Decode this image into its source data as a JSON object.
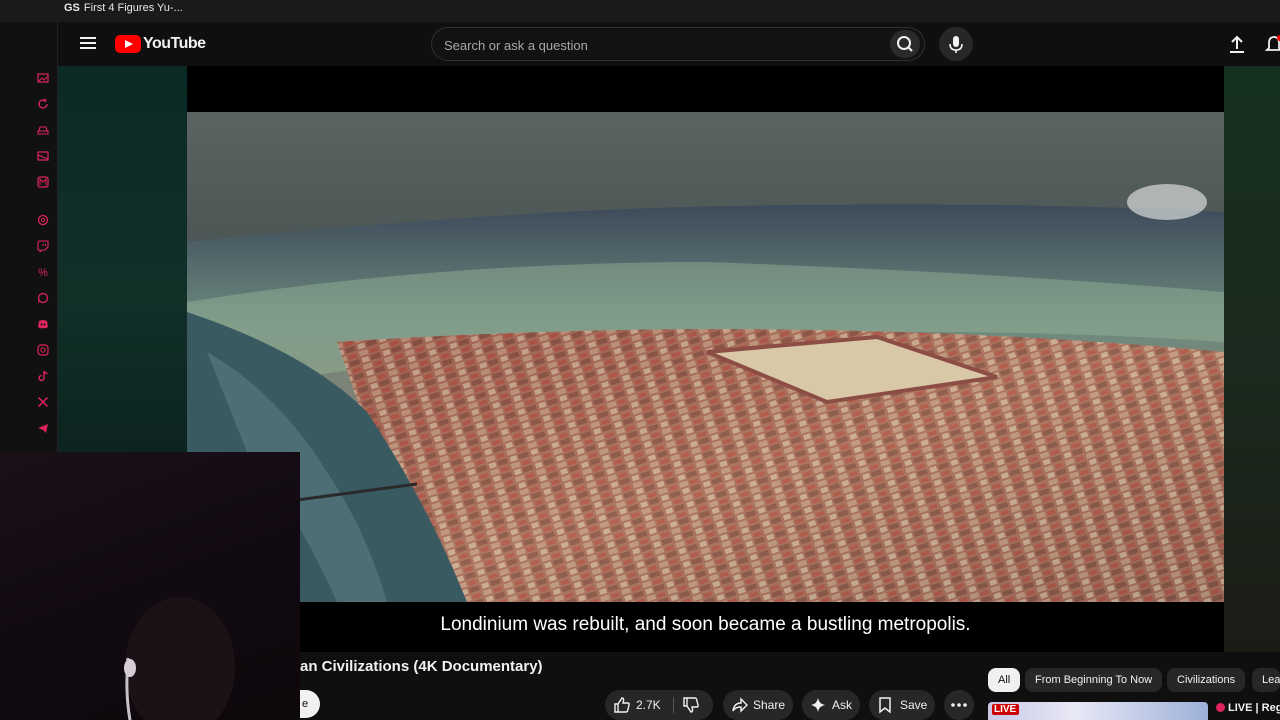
{
  "browser": {
    "tab_prefix": "GS",
    "tab_title": "First 4 Figures Yu-..."
  },
  "header": {
    "logo_text": "YouTube",
    "search_placeholder": "Search or ask a question"
  },
  "left_rail": {
    "icons": [
      "gallery-icon",
      "refresh-icon",
      "car-icon",
      "card-icon",
      "m-badge-icon",
      "threads-icon",
      "twitch-icon",
      "percent-icon",
      "whatsapp-icon",
      "discord-icon",
      "instagram-icon",
      "tiktok-icon",
      "x-icon",
      "telegram-icon"
    ]
  },
  "video": {
    "caption": "Londinium was rebuilt, and soon became a bustling metropolis.",
    "title": "an Civilizations (4K Documentary)"
  },
  "actions": {
    "subscribe_fragment": "e",
    "likes": "2.7K",
    "share_label": "Share",
    "ask_label": "Ask",
    "save_label": "Save"
  },
  "chips": [
    "All",
    "From Beginning To Now",
    "Civilizations",
    "Lea"
  ],
  "recommendation": {
    "live_badge": "LIVE",
    "title": "LIVE | Reg"
  },
  "colors": {
    "accent": "#ff0000",
    "rail_icon": "#e0245e",
    "background": "#0f0f0f"
  }
}
